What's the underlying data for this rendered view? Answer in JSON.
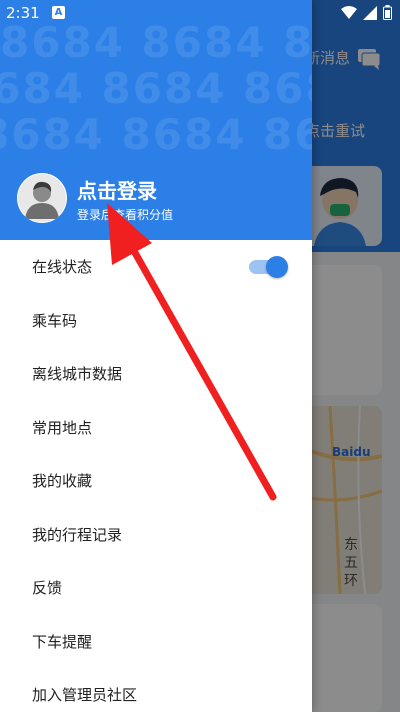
{
  "status_bar": {
    "time": "2:31",
    "notif_letter": "A"
  },
  "background": {
    "new_message_label": "新消息",
    "retry_label": "点击重试",
    "map_brand": "Baidu",
    "map_road_label": "东\n五\n环"
  },
  "drawer": {
    "watermark": "8684 8684 8684 8684",
    "login_title": "点击登录",
    "login_subtitle": "登录后查看积分值",
    "menu": [
      {
        "label": "在线状态",
        "toggle_on": true
      },
      {
        "label": "乘车码"
      },
      {
        "label": "离线城市数据"
      },
      {
        "label": "常用地点"
      },
      {
        "label": "我的收藏"
      },
      {
        "label": "我的行程记录"
      },
      {
        "label": "反馈"
      },
      {
        "label": "下车提醒"
      },
      {
        "label": "加入管理员社区"
      }
    ]
  },
  "colors": {
    "accent": "#2c7fe6",
    "annotation_arrow": "#f02020"
  }
}
